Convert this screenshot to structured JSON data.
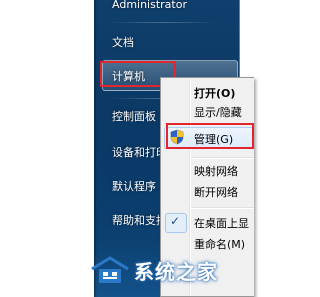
{
  "start_menu": {
    "items": [
      {
        "label": "Administrator"
      },
      {
        "label": "文档"
      },
      {
        "label": "计算机"
      },
      {
        "label": "控制面板"
      },
      {
        "label": "设备和打印"
      },
      {
        "label": "默认程序"
      },
      {
        "label": "帮助和支持"
      }
    ]
  },
  "context_menu": {
    "items": [
      {
        "label": "打开(O)"
      },
      {
        "label": "显示/隐藏"
      },
      {
        "label": "管理(G)"
      },
      {
        "label": "映射网络"
      },
      {
        "label": "断开网络"
      },
      {
        "label": "在桌面上显"
      },
      {
        "label": "重命名(M)"
      }
    ],
    "check_glyph": "✓"
  },
  "watermark": {
    "text": "系统之家"
  },
  "colors": {
    "annotation": "#e1262d",
    "pane_blue": "#0c3a66",
    "menu_bg": "#f0f0f0"
  }
}
